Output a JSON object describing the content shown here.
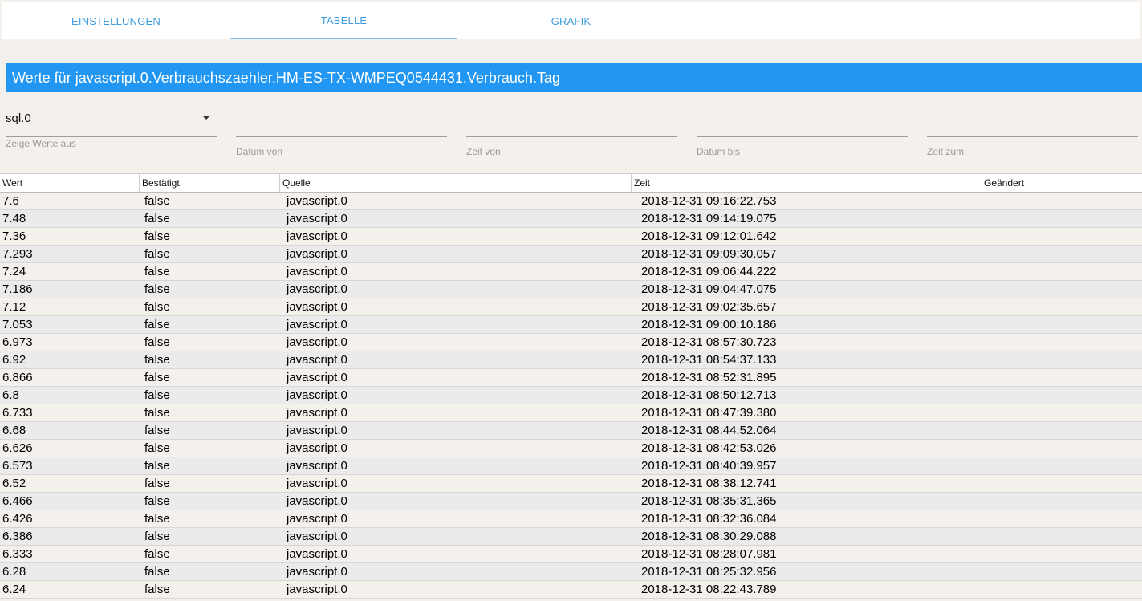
{
  "tabs": [
    {
      "label": "EINSTELLUNGEN"
    },
    {
      "label": "TABELLE"
    },
    {
      "label": "GRAFIK"
    }
  ],
  "title": "Werte für javascript.0.Verbrauchszaehler.HM-ES-TX-WMPEQ0544431.Verbrauch.Tag",
  "filters": {
    "instance": {
      "value": "sql.0",
      "label": "Zeige Werte aus"
    },
    "date_from": {
      "label": "Datum von"
    },
    "time_from": {
      "label": "Zeit von"
    },
    "date_to": {
      "label": "Datum bis"
    },
    "time_to": {
      "label": "Zeit zum"
    }
  },
  "table": {
    "columns": [
      "Wert",
      "Bestätigt",
      "Quelle",
      "Zeit",
      "Geändert"
    ],
    "rows": [
      [
        "7.6",
        "false",
        "javascript.0",
        "2018-12-31 09:16:22.753",
        ""
      ],
      [
        "7.48",
        "false",
        "javascript.0",
        "2018-12-31 09:14:19.075",
        ""
      ],
      [
        "7.36",
        "false",
        "javascript.0",
        "2018-12-31 09:12:01.642",
        ""
      ],
      [
        "7.293",
        "false",
        "javascript.0",
        "2018-12-31 09:09:30.057",
        ""
      ],
      [
        "7.24",
        "false",
        "javascript.0",
        "2018-12-31 09:06:44.222",
        ""
      ],
      [
        "7.186",
        "false",
        "javascript.0",
        "2018-12-31 09:04:47.075",
        ""
      ],
      [
        "7.12",
        "false",
        "javascript.0",
        "2018-12-31 09:02:35.657",
        ""
      ],
      [
        "7.053",
        "false",
        "javascript.0",
        "2018-12-31 09:00:10.186",
        ""
      ],
      [
        "6.973",
        "false",
        "javascript.0",
        "2018-12-31 08:57:30.723",
        ""
      ],
      [
        "6.92",
        "false",
        "javascript.0",
        "2018-12-31 08:54:37.133",
        ""
      ],
      [
        "6.866",
        "false",
        "javascript.0",
        "2018-12-31 08:52:31.895",
        ""
      ],
      [
        "6.8",
        "false",
        "javascript.0",
        "2018-12-31 08:50:12.713",
        ""
      ],
      [
        "6.733",
        "false",
        "javascript.0",
        "2018-12-31 08:47:39.380",
        ""
      ],
      [
        "6.68",
        "false",
        "javascript.0",
        "2018-12-31 08:44:52.064",
        ""
      ],
      [
        "6.626",
        "false",
        "javascript.0",
        "2018-12-31 08:42:53.026",
        ""
      ],
      [
        "6.573",
        "false",
        "javascript.0",
        "2018-12-31 08:40:39.957",
        ""
      ],
      [
        "6.52",
        "false",
        "javascript.0",
        "2018-12-31 08:38:12.741",
        ""
      ],
      [
        "6.466",
        "false",
        "javascript.0",
        "2018-12-31 08:35:31.365",
        ""
      ],
      [
        "6.426",
        "false",
        "javascript.0",
        "2018-12-31 08:32:36.084",
        ""
      ],
      [
        "6.386",
        "false",
        "javascript.0",
        "2018-12-31 08:30:29.088",
        ""
      ],
      [
        "6.333",
        "false",
        "javascript.0",
        "2018-12-31 08:28:07.981",
        ""
      ],
      [
        "6.28",
        "false",
        "javascript.0",
        "2018-12-31 08:25:32.956",
        ""
      ],
      [
        "6.24",
        "false",
        "javascript.0",
        "2018-12-31 08:22:43.789",
        ""
      ]
    ]
  },
  "colors": {
    "accent": "#2196f3",
    "tab_text": "#3d9de0"
  }
}
